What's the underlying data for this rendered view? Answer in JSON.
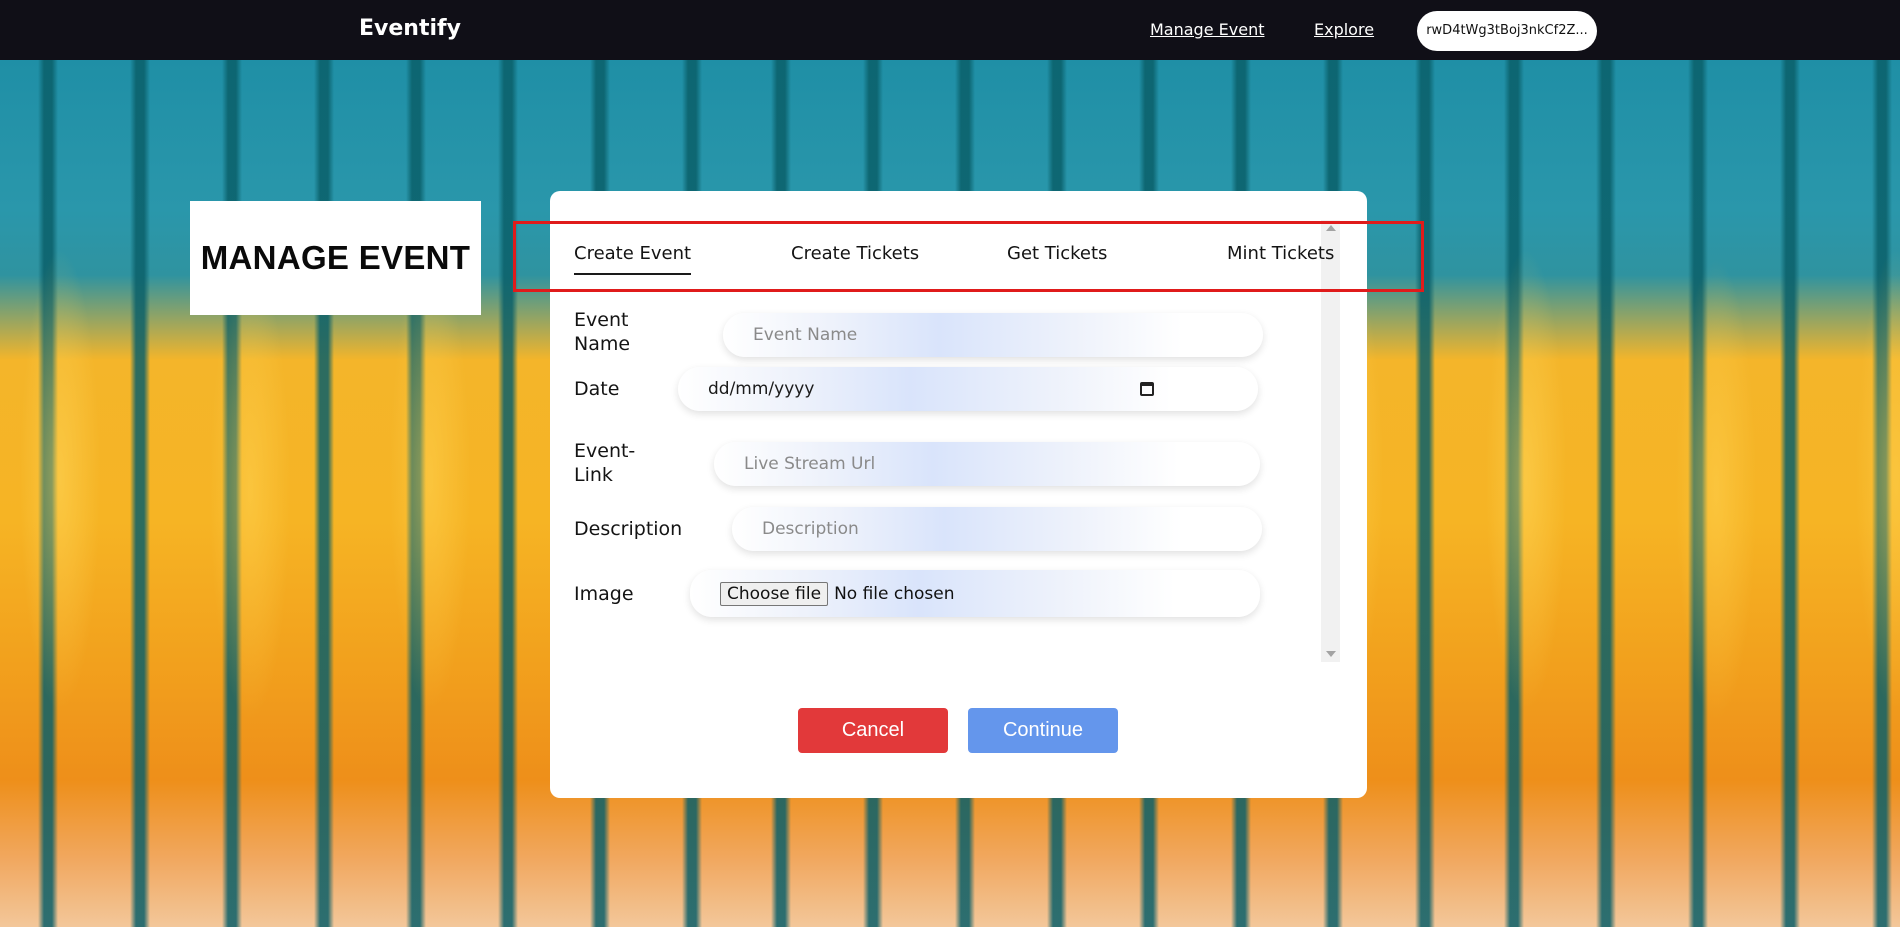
{
  "navbar": {
    "brand": "Eventify",
    "links": [
      "Manage Event",
      "Explore"
    ],
    "wallet_address": "rwD4tWg3tBoj3nkCf2Z..."
  },
  "page": {
    "title": "MANAGE EVENT"
  },
  "tabs": {
    "items": [
      "Create Event",
      "Create Tickets",
      "Get Tickets",
      "Mint Tickets"
    ],
    "active": "Create Event"
  },
  "form": {
    "event_name": {
      "label": "Event Name",
      "placeholder": "Event Name"
    },
    "date": {
      "label": "Date",
      "value": "dd/mm/yyyy"
    },
    "event_link": {
      "label": "Event-Link",
      "placeholder": "Live Stream Url"
    },
    "description": {
      "label": "Description",
      "placeholder": "Description"
    },
    "image": {
      "label": "Image",
      "button": "Choose file",
      "status": "No file chosen"
    }
  },
  "actions": {
    "cancel": "Cancel",
    "continue": "Continue"
  },
  "colors": {
    "navbar_bg": "#100f17",
    "cancel_bg": "#e2393a",
    "continue_bg": "#6496ec",
    "highlight_border": "#e01b1b"
  }
}
